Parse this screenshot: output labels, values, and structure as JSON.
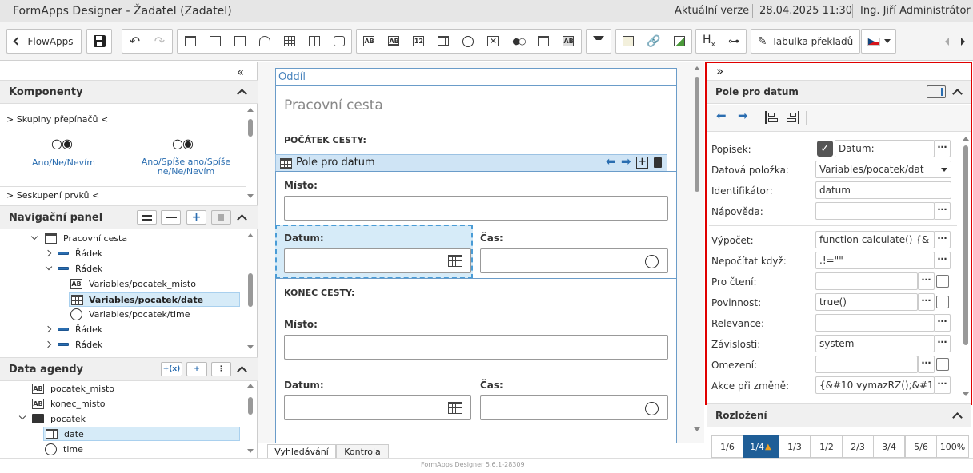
{
  "titlebar": {
    "app_title": "FormApps Designer - Žadatel (Zadatel)",
    "version": "Aktuální verze",
    "datetime": "28.04.2025 11:30",
    "user": "Ing. Jiří Administrátor"
  },
  "toolbar": {
    "flowapps_label": "FlowApps",
    "translations_label": "Tabulka překladů",
    "tool_text_1": "AB",
    "tool_text_2": "AB",
    "tool_number": "12",
    "tool_hx": "H",
    "tool_hx_sub": "x",
    "tool_text_3": "AB"
  },
  "components": {
    "title": "Komponenty",
    "group1": "> Skupiny přepínačů <",
    "item1": "Ano/Ne/Nevím",
    "item2": "Ano/Spíše ano/Spíše ne/Ne/Nevím",
    "group2": "> Seskupení prvků <"
  },
  "nav": {
    "title": "Navigační panel",
    "items": [
      {
        "label": "Pracovní cesta"
      },
      {
        "label": "Řádek"
      },
      {
        "label": "Řádek"
      },
      {
        "label": "Variables/pocatek_misto",
        "icon": "AB"
      },
      {
        "label": "Variables/pocatek/date"
      },
      {
        "label": "Variables/pocatek/time"
      },
      {
        "label": "Řádek"
      },
      {
        "label": "Řádek"
      }
    ]
  },
  "agenda": {
    "title": "Data agendy",
    "items": [
      {
        "label": "pocatek_misto",
        "icon": "AB"
      },
      {
        "label": "konec_misto",
        "icon": "AB"
      },
      {
        "label": "pocatek"
      },
      {
        "label": "date"
      },
      {
        "label": "time"
      }
    ],
    "btn1": "+(x)",
    "btn2": "+"
  },
  "canvas": {
    "section_label": "Oddíl",
    "heading": "Pracovní cesta",
    "start_label": "POČÁTEK CESTY:",
    "selected_field": "Pole pro datum",
    "place1": "Místo:",
    "date1": "Datum:",
    "time1": "Čas:",
    "end_label": "KONEC CESTY:",
    "place2": "Místo:",
    "date2": "Datum:",
    "time2": "Čas:",
    "tab_search": "Vyhledávání",
    "tab_check": "Kontrola"
  },
  "footer": {
    "version": "FormApps Designer 5.6.1-28309"
  },
  "props": {
    "title": "Pole pro datum",
    "rows": [
      {
        "label": "Popisek:",
        "value": "Datum:"
      },
      {
        "label": "Datová položka:",
        "value": "Variables/pocatek/dat"
      },
      {
        "label": "Identifikátor:",
        "value": "datum"
      },
      {
        "label": "Nápověda:",
        "value": ""
      },
      {
        "label": "Výpočet:",
        "value": "function calculate() {&"
      },
      {
        "label": "Nepočítat když:",
        "value": ".!=\"\""
      },
      {
        "label": "Pro čtení:",
        "value": ""
      },
      {
        "label": "Povinnost:",
        "value": "true()"
      },
      {
        "label": "Relevance:",
        "value": ""
      },
      {
        "label": "Závislosti:",
        "value": "system"
      },
      {
        "label": "Omezení:",
        "value": ""
      },
      {
        "label": "Akce při změně:",
        "value": "{&#10  vymazRZ();&#1("
      }
    ],
    "dots": "⋯"
  },
  "layout": {
    "title": "Rozložení",
    "options": [
      "1/6",
      "1/4",
      "1/3",
      "1/2",
      "2/3",
      "3/4",
      "5/6",
      "100%"
    ],
    "selected": "1/4"
  }
}
